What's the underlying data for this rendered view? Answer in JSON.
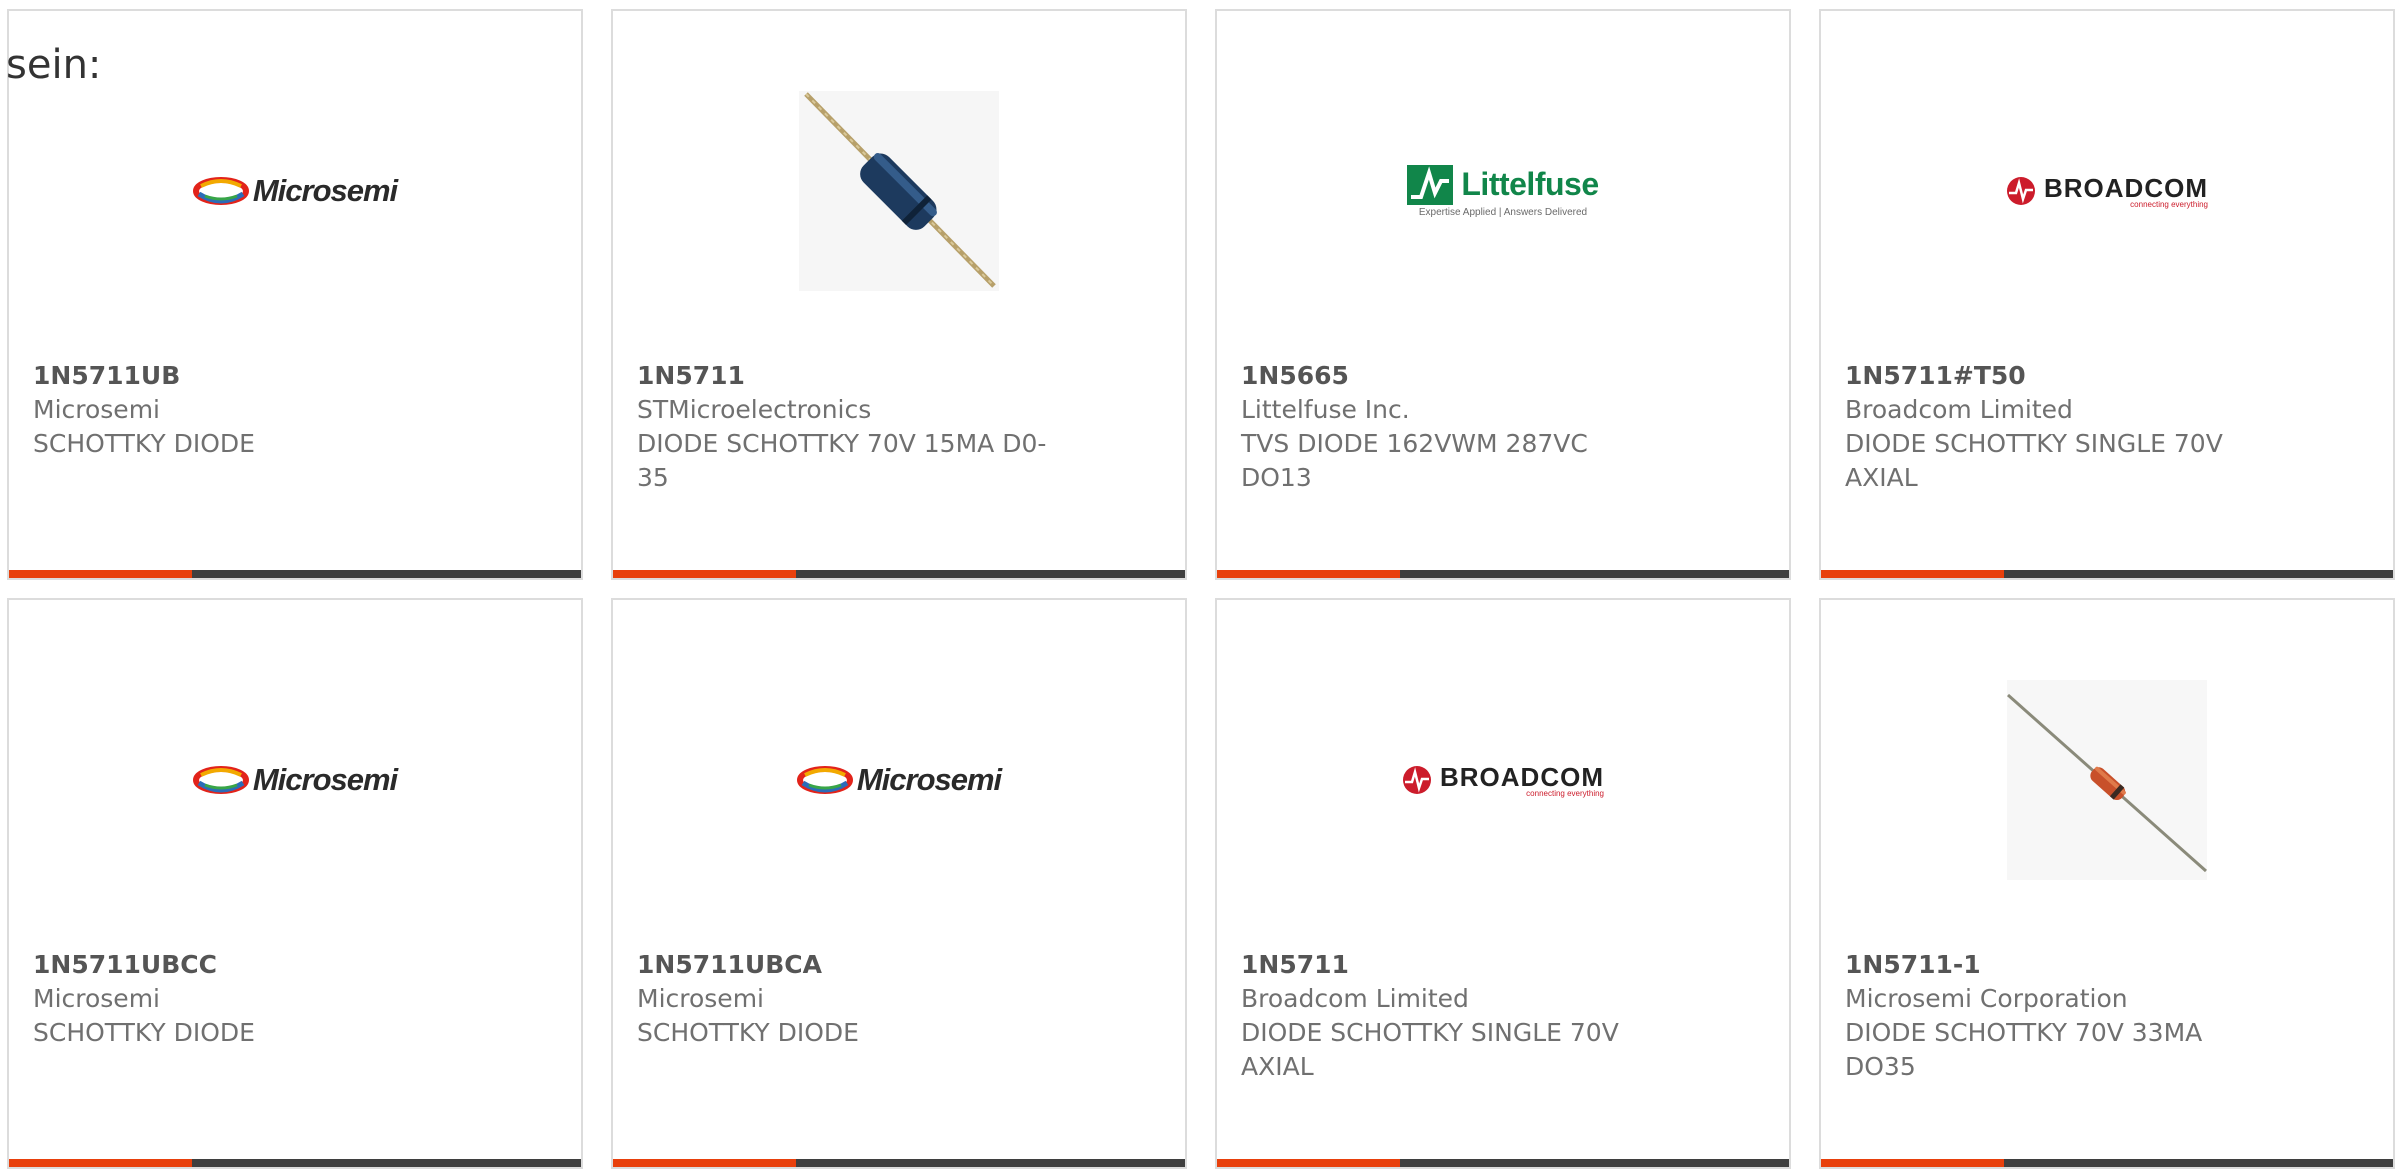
{
  "top_text": "sein:",
  "colors": {
    "accent": "#e8400c",
    "bar": "#3f3f3f",
    "border": "#dcdcdc",
    "microsemi_ring_red": "#e2231a",
    "littelfuse_green": "#11864a",
    "broadcom_red": "#cc1c2b"
  },
  "logos": {
    "microsemi": "Microsemi",
    "broadcom": "BROADCOM",
    "broadcom_tagline": "connecting everything",
    "littelfuse": "Littelfuse",
    "littelfuse_tagline": "Expertise Applied | Answers Delivered"
  },
  "cards": [
    {
      "image": "microsemi-logo",
      "part_number": "1N5711UB",
      "manufacturer": "Microsemi",
      "description_lines": [
        "SCHOTTKY DIODE"
      ]
    },
    {
      "image": "axial-diode-blue-photo",
      "part_number": "1N5711",
      "manufacturer": "STMicroelectronics",
      "description_lines": [
        "DIODE SCHOTTKY 70V 15MA D0-",
        "35"
      ]
    },
    {
      "image": "littelfuse-logo",
      "part_number": "1N5665",
      "manufacturer": "Littelfuse Inc.",
      "description_lines": [
        "TVS DIODE 162VWM 287VC",
        "DO13"
      ]
    },
    {
      "image": "broadcom-logo",
      "part_number": "1N5711#T50",
      "manufacturer": "Broadcom Limited",
      "description_lines": [
        "DIODE SCHOTTKY SINGLE 70V",
        "AXIAL"
      ]
    },
    {
      "image": "microsemi-logo",
      "part_number": "1N5711UBCC",
      "manufacturer": "Microsemi",
      "description_lines": [
        "SCHOTTKY DIODE"
      ]
    },
    {
      "image": "microsemi-logo",
      "part_number": "1N5711UBCA",
      "manufacturer": "Microsemi",
      "description_lines": [
        "SCHOTTKY DIODE"
      ]
    },
    {
      "image": "broadcom-logo",
      "part_number": "1N5711",
      "manufacturer": "Broadcom Limited",
      "description_lines": [
        "DIODE SCHOTTKY SINGLE 70V",
        "AXIAL"
      ]
    },
    {
      "image": "axial-diode-orange-photo",
      "part_number": "1N5711-1",
      "manufacturer": "Microsemi Corporation",
      "description_lines": [
        "DIODE SCHOTTKY 70V 33MA",
        "DO35"
      ]
    }
  ]
}
